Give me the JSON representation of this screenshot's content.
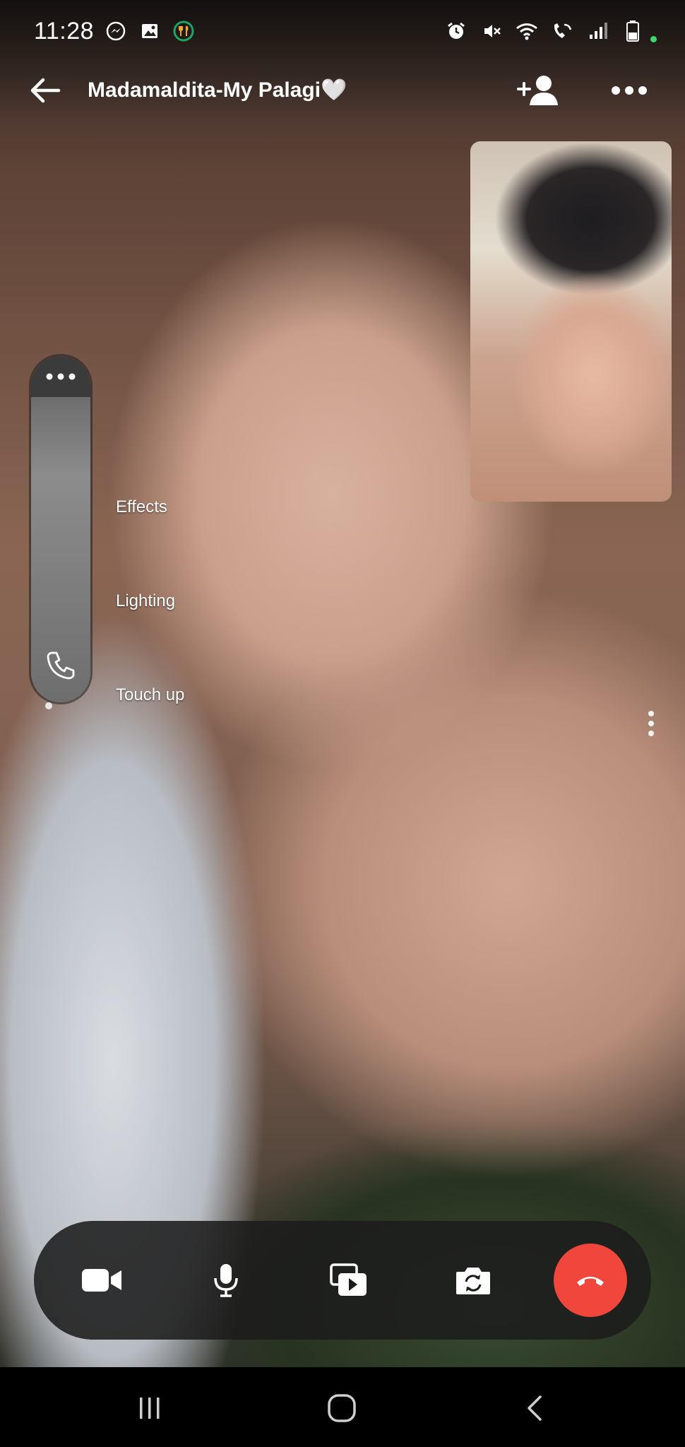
{
  "status_bar": {
    "time": "11:28",
    "left_icons": [
      "messenger-icon",
      "gallery-icon",
      "food-app-icon"
    ],
    "right_icons": [
      "alarm-icon",
      "mute-icon",
      "wifi-icon",
      "wifi-calling-icon",
      "signal-icon",
      "battery-icon"
    ]
  },
  "header": {
    "title": "Madamaldita-My Palagi🤍",
    "back_icon": "back-arrow-icon",
    "add_icon": "add-person-icon",
    "more_icon": "more-horizontal-icon"
  },
  "side_rail": {
    "top_icon": "more-horizontal-icon",
    "bottom_icon": "phone-icon"
  },
  "effects_menu": {
    "items": [
      "Effects",
      "Lighting",
      "Touch up"
    ]
  },
  "controls": {
    "icons": [
      "video-camera-icon",
      "microphone-icon",
      "share-media-icon",
      "flip-camera-icon",
      "end-call-icon"
    ],
    "end_call_color": "#f0463c"
  },
  "nav_bar": {
    "icons": [
      "recent-apps-icon",
      "home-icon",
      "back-icon"
    ]
  }
}
